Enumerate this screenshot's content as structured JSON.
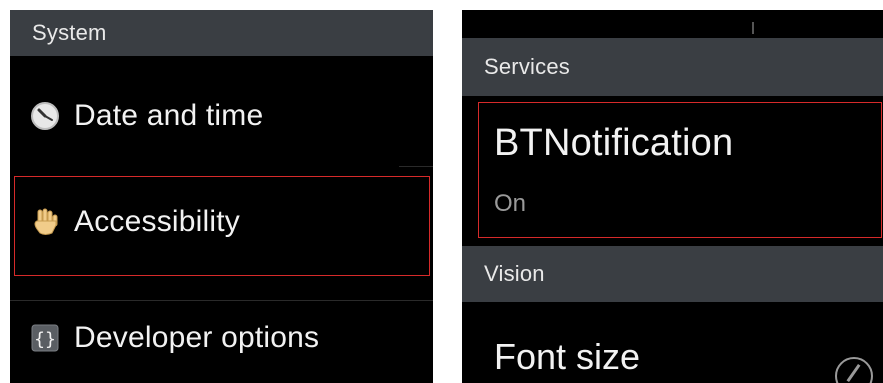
{
  "left": {
    "section_header": "System",
    "items": [
      {
        "label": "Date and time",
        "icon": "clock-icon"
      },
      {
        "label": "Accessibility",
        "icon": "hand-icon"
      },
      {
        "label": "Developer options",
        "icon": "braces-icon"
      }
    ]
  },
  "right": {
    "section_services": "Services",
    "service_item": {
      "title": "BTNotification",
      "status": "On"
    },
    "section_vision": "Vision",
    "vision_item": {
      "title": "Font size"
    }
  },
  "colors": {
    "background": "#000000",
    "header_bg": "#3a3e43",
    "highlight": "#d62a2a",
    "text": "#f2f2f2",
    "subtext": "#9a9a9a"
  }
}
